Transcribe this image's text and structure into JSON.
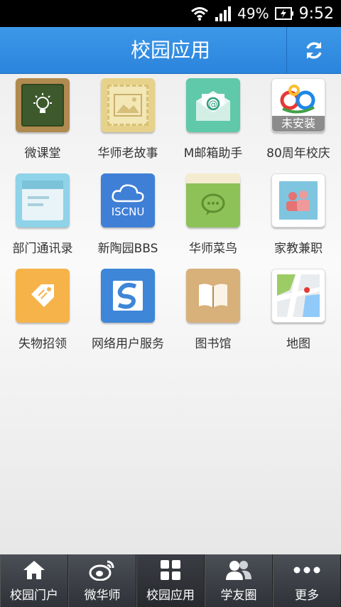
{
  "status_bar": {
    "battery": "49%",
    "time": "9:52"
  },
  "header": {
    "title": "校园应用"
  },
  "apps": [
    {
      "label": "微课堂",
      "icon": "lightbulb-icon"
    },
    {
      "label": "华师老故事",
      "icon": "stamp-photo-icon"
    },
    {
      "label": "M邮箱助手",
      "icon": "envelope-at-icon"
    },
    {
      "label": "80周年校庆",
      "icon": "anniversary-logo-icon",
      "badge": "未安装"
    },
    {
      "label": "部门通讯录",
      "icon": "address-book-icon"
    },
    {
      "label": "新陶园BBS",
      "icon": "cloud-iscnu-icon",
      "icon_text": "ISCNU"
    },
    {
      "label": "华师菜鸟",
      "icon": "chat-bubble-icon"
    },
    {
      "label": "家教兼职",
      "icon": "people-icon"
    },
    {
      "label": "失物招领",
      "icon": "tag-icon"
    },
    {
      "label": "网络用户服务",
      "icon": "s-logo-icon"
    },
    {
      "label": "图书馆",
      "icon": "book-icon"
    },
    {
      "label": "地图",
      "icon": "map-pin-icon"
    }
  ],
  "tabs": [
    {
      "label": "校园门户",
      "icon": "home-icon"
    },
    {
      "label": "微华师",
      "icon": "weibo-icon"
    },
    {
      "label": "校园应用",
      "icon": "grid-icon",
      "active": true
    },
    {
      "label": "学友圈",
      "icon": "friends-icon"
    },
    {
      "label": "更多",
      "icon": "more-dots-icon"
    }
  ]
}
